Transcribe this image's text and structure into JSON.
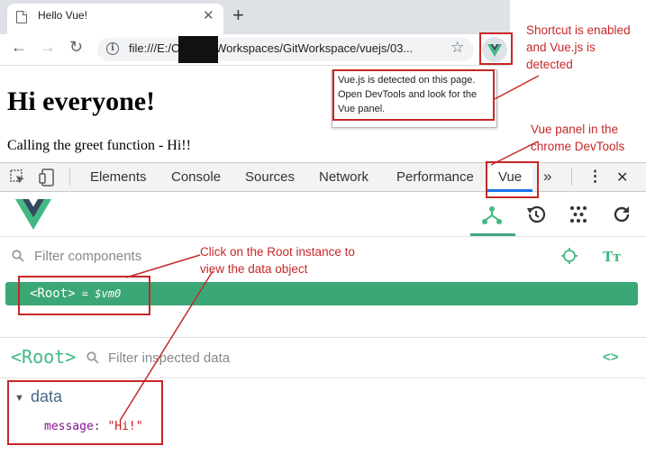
{
  "browser": {
    "tab_title": "Hello Vue!",
    "tab_close": "✕",
    "new_tab": "+",
    "url": "file:///E:/Chandu/Workspaces/GitWorkspace/vuejs/03..."
  },
  "popup": {
    "text": "Vue.js is detected on this page. Open DevTools and look for the Vue panel."
  },
  "page": {
    "heading": "Hi everyone!",
    "paragraph": "Calling the greet function - Hi!!"
  },
  "devtools": {
    "tabs": [
      "Elements",
      "Console",
      "Sources",
      "Network",
      "Performance"
    ],
    "active_tab": "Vue",
    "more": "»",
    "kebab": "⋮",
    "close": "✕"
  },
  "vue_panel": {
    "filter_placeholder": "Filter components",
    "font_toggle": "Tт",
    "root_label": "<Root>",
    "root_eq": " = ",
    "root_vm": "$vm0",
    "inspect_title": "<Root>",
    "inspect_filter_placeholder": "Filter inspected data",
    "code_toggle": "<>",
    "section": "data",
    "message_key": "message",
    "message_value": "\"Hi!\""
  },
  "annotations": {
    "shortcut": "Shortcut is enabled and Vue.js is detected",
    "panel": "Vue panel in the chrome DevTools",
    "root": "Click on the Root instance to view the data object"
  },
  "colors": {
    "vue_green": "#42b983",
    "vue_dark": "#35495e",
    "root_row": "#3ba776",
    "annotation_red": "#c62828"
  }
}
